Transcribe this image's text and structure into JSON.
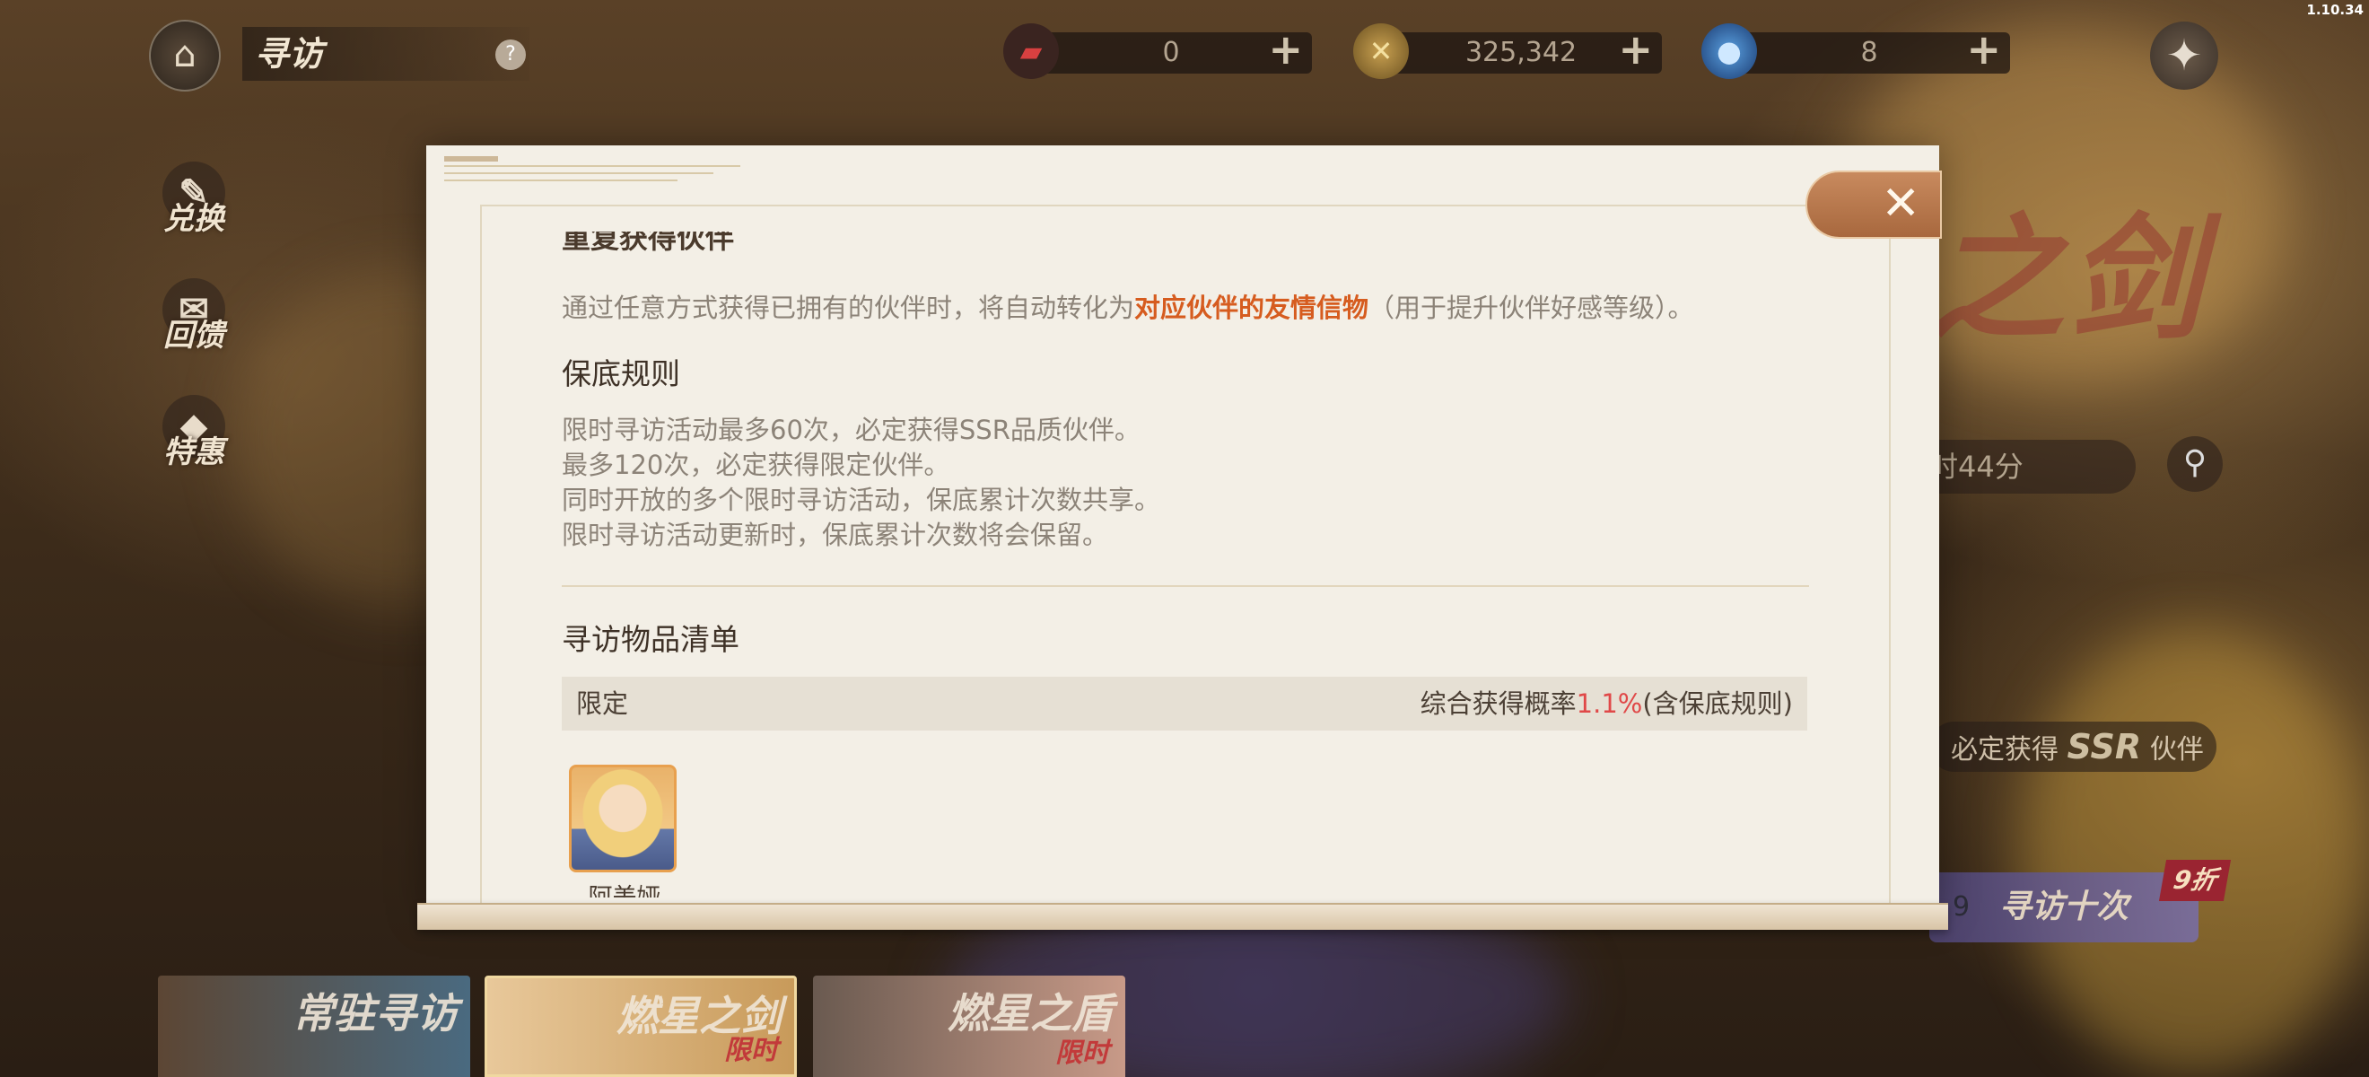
{
  "version": "1.10.34",
  "header": {
    "home_icon": "home-icon",
    "title": "寻访",
    "help_label": "?",
    "currencies": [
      {
        "name": "ticket",
        "value": "0",
        "icon": "ticket-icon"
      },
      {
        "name": "gold",
        "value": "325,342",
        "icon": "coin-icon"
      },
      {
        "name": "gem",
        "value": "8",
        "icon": "gem-icon"
      }
    ],
    "plus_label": "+",
    "settings_icon": "settings-icon"
  },
  "side_nav": [
    {
      "label": "兑换",
      "icon": "scroll-icon"
    },
    {
      "label": "回馈",
      "icon": "gift-icon"
    },
    {
      "label": "特惠",
      "icon": "tag-icon"
    }
  ],
  "background": {
    "banner_title": "之剑",
    "timer_text": "时44分",
    "ssr_prefix": "必定获得",
    "ssr_badge": "SSR",
    "ssr_suffix": "伙伴",
    "ten_pull_label": "寻访十次",
    "ten_pull_count": "9",
    "discount_badge": "9折"
  },
  "tabs": [
    {
      "label": "常驻寻访",
      "tag": ""
    },
    {
      "label": "燃星之剑",
      "tag": "限时"
    },
    {
      "label": "燃星之盾",
      "tag": "限时"
    }
  ],
  "modal": {
    "close_icon": "close-icon",
    "cut_heading": "重复获得伙伴",
    "dup_text_pre": "通过任意方式获得已拥有的伙伴时，将自动转化为",
    "dup_text_highlight": "对应伙伴的友情信物",
    "dup_text_post": "（用于提升伙伴好感等级）。",
    "pity_heading": "保底规则",
    "pity_lines": [
      "限时寻访活动最多60次，必定获得SSR品质伙伴。",
      "最多120次，必定获得限定伙伴。",
      "同时开放的多个限时寻访活动，保底累计次数共享。",
      "限时寻访活动更新时，保底累计次数将会保留。"
    ],
    "list_heading": "寻访物品清单",
    "table": {
      "category": "限定",
      "rate_prefix": "综合获得概率",
      "rate_value": "1.1%",
      "rate_suffix": "(含保底规则)"
    },
    "items": [
      {
        "name": "阿美娅"
      }
    ]
  }
}
